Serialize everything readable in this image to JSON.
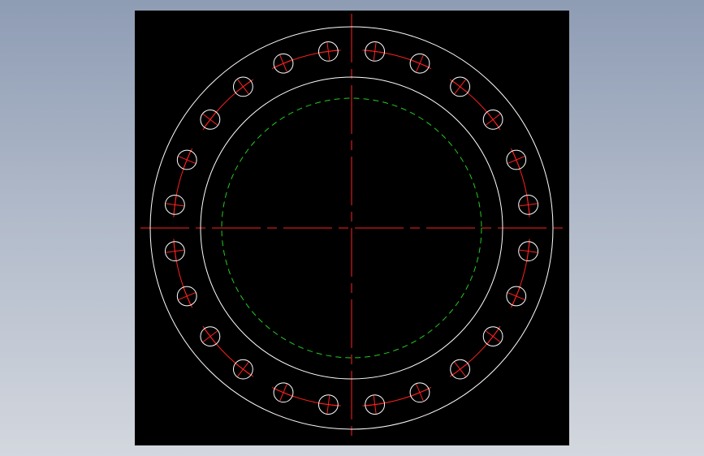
{
  "drawing": {
    "background_color": "#000000",
    "page_background": [
      "#8e9cb4",
      "#d3d7de"
    ],
    "colors": {
      "outline": "#ffffff",
      "centerline": "#ff2020",
      "hidden_circle": "#22cc22",
      "bolt_holes": "#ffffff",
      "bolt_marks": "#ff2020"
    },
    "flange": {
      "bolt_count": 24,
      "outer_diameter_ratio": 1.0,
      "inner_diameter_ratio": 0.75,
      "dashed_circle_ratio": 0.645,
      "bolt_circle_ratio": 0.885,
      "bolt_hole_ratio": 0.048,
      "first_bolt_angle_deg": 7.5
    }
  }
}
